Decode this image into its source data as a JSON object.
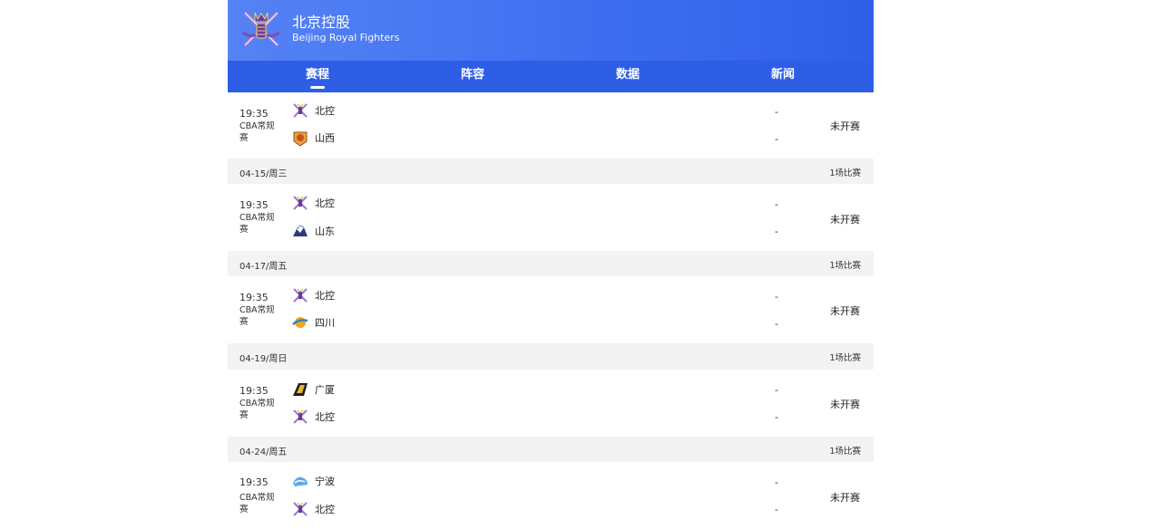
{
  "header": {
    "team_name_cn": "北京控股",
    "team_name_en": "Beijing Royal Fighters",
    "logo_icon": "beijing-royal-fighters-crest"
  },
  "tabs": [
    {
      "label": "赛程",
      "active": true
    },
    {
      "label": "阵容",
      "active": false
    },
    {
      "label": "数据",
      "active": false
    },
    {
      "label": "新闻",
      "active": false
    }
  ],
  "matches": [
    {
      "time": "19:35",
      "league": "CBA常规赛",
      "home": {
        "name": "北控",
        "icon": "beikong-logo"
      },
      "away": {
        "name": "山西",
        "icon": "shanxi-logo"
      },
      "home_score": "-",
      "away_score": "-",
      "status": "未开赛"
    },
    {
      "time": "19:35",
      "league": "CBA常规赛",
      "home": {
        "name": "北控",
        "icon": "beikong-logo"
      },
      "away": {
        "name": "山东",
        "icon": "shandong-logo"
      },
      "home_score": "-",
      "away_score": "-",
      "status": "未开赛"
    },
    {
      "time": "19:35",
      "league": "CBA常规赛",
      "home": {
        "name": "北控",
        "icon": "beikong-logo"
      },
      "away": {
        "name": "四川",
        "icon": "sichuan-logo"
      },
      "home_score": "-",
      "away_score": "-",
      "status": "未开赛"
    },
    {
      "time": "19:35",
      "league": "CBA常规赛",
      "home": {
        "name": "广厦",
        "icon": "guangsha-logo"
      },
      "away": {
        "name": "北控",
        "icon": "beikong-logo"
      },
      "home_score": "-",
      "away_score": "-",
      "status": "未开赛"
    },
    {
      "time": "19:35",
      "league": "CBA常规赛",
      "home": {
        "name": "宁波",
        "icon": "ningbo-logo"
      },
      "away": {
        "name": "北控",
        "icon": "beikong-logo"
      },
      "home_score": "-",
      "away_score": "-",
      "status": "未开赛"
    }
  ],
  "date_bars": [
    {
      "date": "04-15/周三",
      "count": "1场比赛"
    },
    {
      "date": "04-17/周五",
      "count": "1场比赛"
    },
    {
      "date": "04-19/周日",
      "count": "1场比赛"
    },
    {
      "date": "04-24/周五",
      "count": "1场比赛"
    }
  ],
  "colors": {
    "header_start": "#5583f5",
    "header_end": "#2f5fe8",
    "tab_bar": "#2e5de6",
    "date_bar": "#f3f3f3"
  }
}
